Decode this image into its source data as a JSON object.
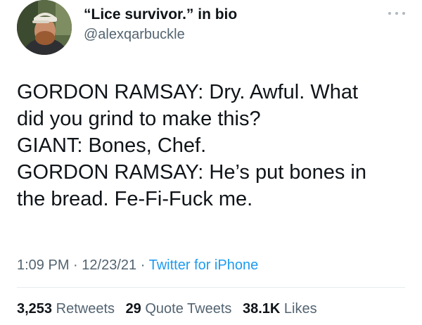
{
  "user": {
    "display_name": "“Lice survivor.” in bio",
    "handle": "@alexqarbuckle"
  },
  "tweet": {
    "lines": [
      "GORDON RAMSAY: Dry. Awful. What",
      "did you grind to make this?",
      "GIANT: Bones, Chef.",
      "GORDON RAMSAY: He’s put bones in",
      "the bread. Fe-Fi-Fuck me."
    ]
  },
  "meta": {
    "time": "1:09 PM",
    "separator": "·",
    "date": "12/23/21",
    "source": "Twitter for iPhone"
  },
  "stats": {
    "retweets_count": "3,253",
    "retweets_label": "Retweets",
    "quotes_count": "29",
    "quotes_label": "Quote Tweets",
    "likes_count": "38.1K",
    "likes_label": "Likes"
  },
  "colors": {
    "text": "#0f1419",
    "secondary": "#536471",
    "link": "#1d9bf0",
    "divider": "#e6ecf0"
  },
  "icons": {
    "more": "more-dots-icon",
    "avatar": "profile-photo"
  }
}
